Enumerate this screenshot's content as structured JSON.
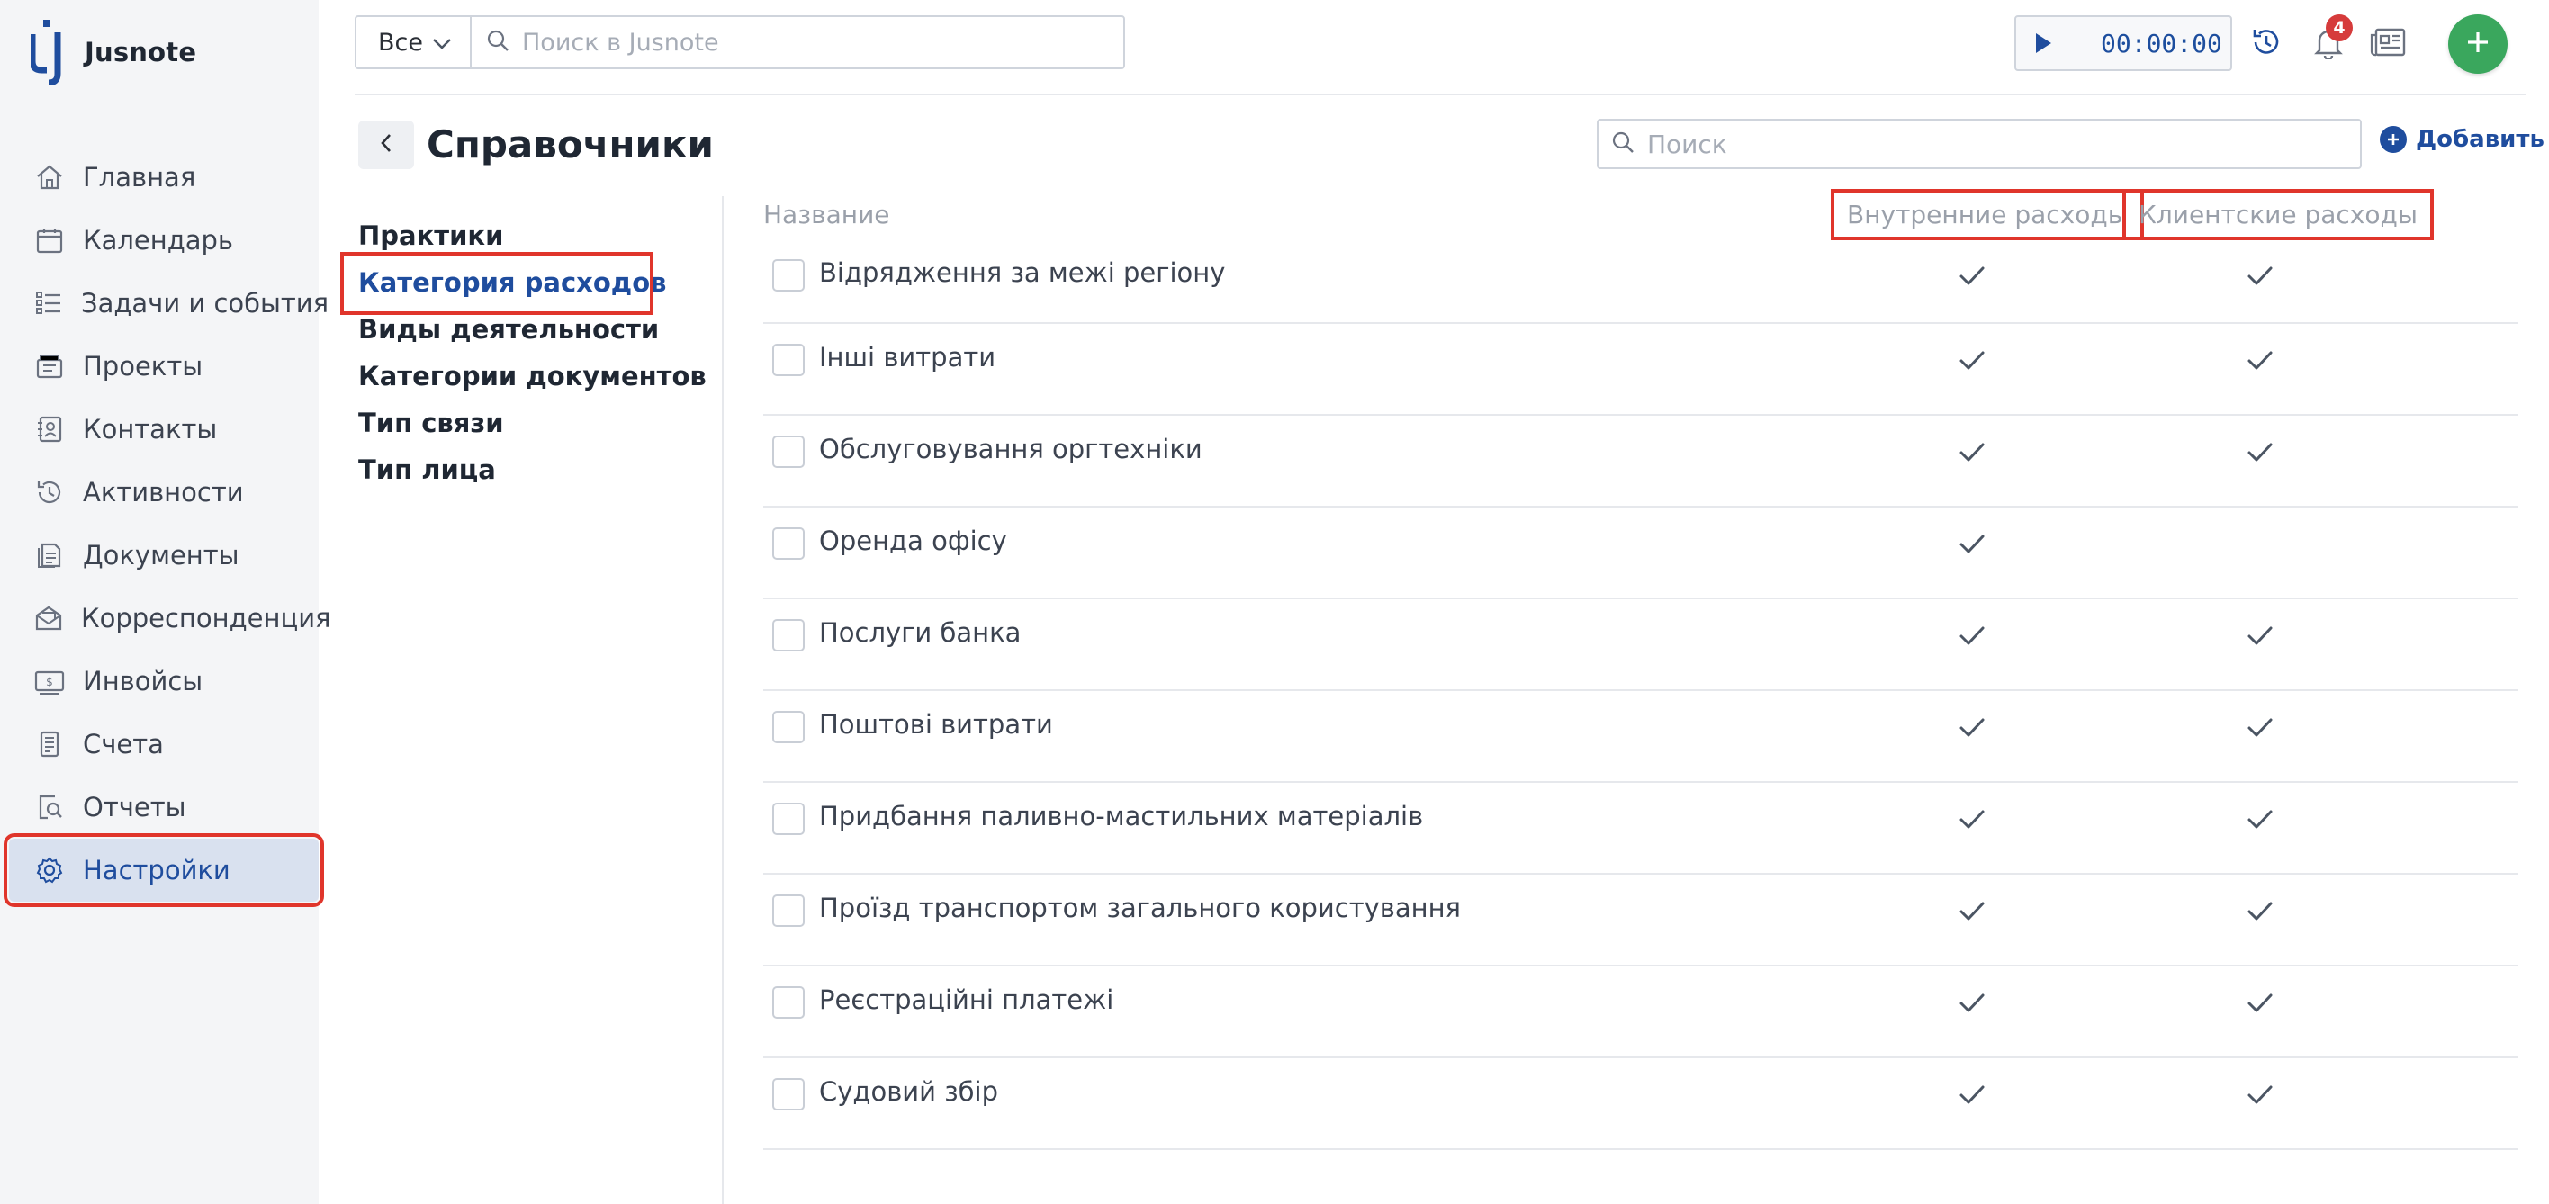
{
  "app": {
    "name": "Jusnote",
    "brand_color": "#1f4d9e",
    "accent_red": "#e0352b",
    "fab_color": "#3aa75d"
  },
  "sidebar": {
    "items": [
      {
        "label": "Главная",
        "icon": "home-icon",
        "active": false
      },
      {
        "label": "Календарь",
        "icon": "calendar-icon",
        "active": false
      },
      {
        "label": "Задачи и события",
        "icon": "tasks-icon",
        "active": false
      },
      {
        "label": "Проекты",
        "icon": "projects-icon",
        "active": false
      },
      {
        "label": "Контакты",
        "icon": "contacts-icon",
        "active": false
      },
      {
        "label": "Активности",
        "icon": "history-icon",
        "active": false
      },
      {
        "label": "Документы",
        "icon": "documents-icon",
        "active": false
      },
      {
        "label": "Корреспонденция",
        "icon": "mail-icon",
        "active": false
      },
      {
        "label": "Инвойсы",
        "icon": "invoice-icon",
        "active": false
      },
      {
        "label": "Счета",
        "icon": "accounts-icon",
        "active": false
      },
      {
        "label": "Отчеты",
        "icon": "reports-icon",
        "active": false
      },
      {
        "label": "Настройки",
        "icon": "gear-icon",
        "active": true
      }
    ]
  },
  "topbar": {
    "scope_value": "Все",
    "search_placeholder": "Поиск в Jusnote",
    "timer_value": "00:00:00",
    "notifications_count": "4"
  },
  "page": {
    "title": "Справочники",
    "search_placeholder": "Поиск",
    "add_label": "Добавить"
  },
  "submenu": {
    "items": [
      {
        "label": "Практики",
        "active": false
      },
      {
        "label": "Категория расходов",
        "active": true
      },
      {
        "label": "Виды деятельности",
        "active": false
      },
      {
        "label": "Категории документов",
        "active": false
      },
      {
        "label": "Тип связи",
        "active": false
      },
      {
        "label": "Тип лица",
        "active": false
      }
    ]
  },
  "table": {
    "columns": {
      "name": "Название",
      "internal": "Внутренние расходы",
      "client": "Клиентские расходы"
    },
    "rows": [
      {
        "name": "Відрядження за межі регіону",
        "internal": true,
        "client": true
      },
      {
        "name": "Інші витрати",
        "internal": true,
        "client": true
      },
      {
        "name": "Обслуговування оргтехніки",
        "internal": true,
        "client": true
      },
      {
        "name": "Оренда офісу",
        "internal": true,
        "client": false
      },
      {
        "name": "Послуги банка",
        "internal": true,
        "client": true
      },
      {
        "name": "Поштові витрати",
        "internal": true,
        "client": true
      },
      {
        "name": "Придбання паливно-мастильних матеріалів",
        "internal": true,
        "client": true
      },
      {
        "name": "Проїзд транспортом загального користування",
        "internal": true,
        "client": true
      },
      {
        "name": "Реєстраційні платежі",
        "internal": true,
        "client": true
      },
      {
        "name": "Судовий збір",
        "internal": true,
        "client": true
      }
    ]
  }
}
